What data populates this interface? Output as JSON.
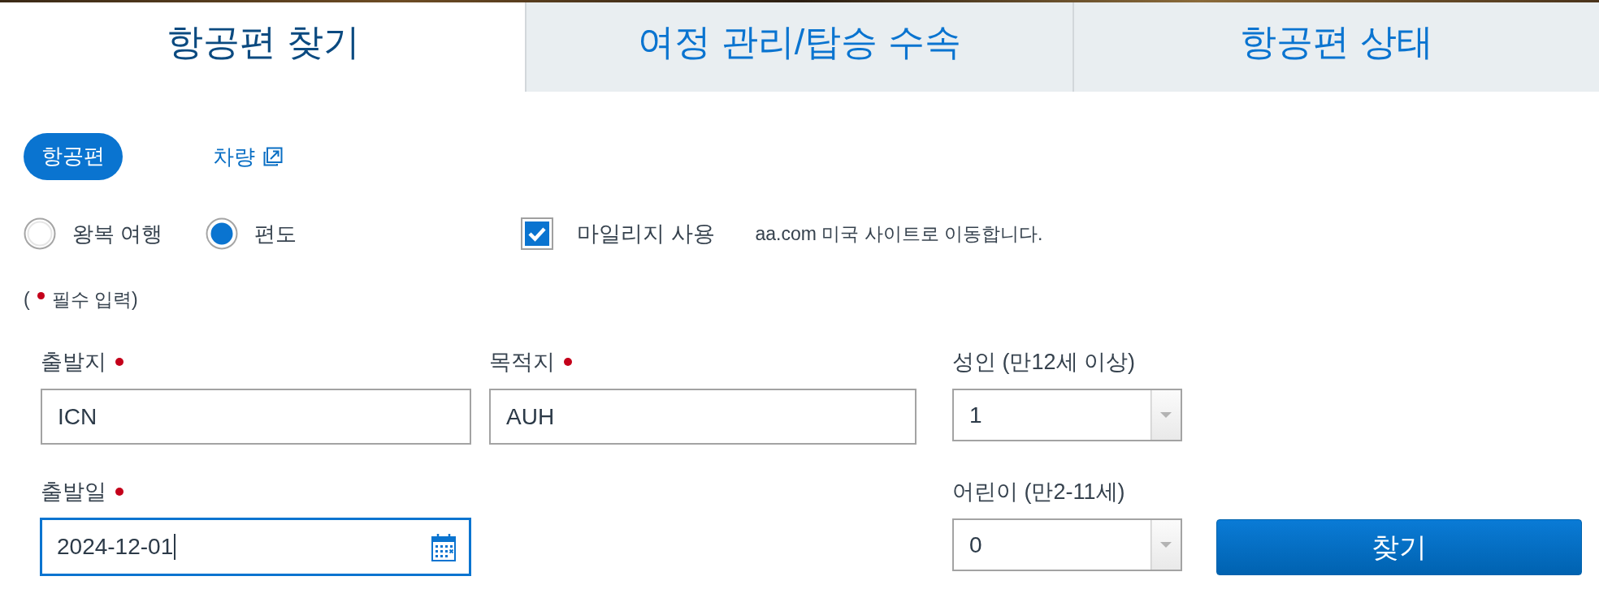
{
  "tabs": [
    {
      "label": "항공편 찾기",
      "selected": true
    },
    {
      "label": "여정 관리/탑승 수속",
      "selected": false
    },
    {
      "label": "항공편 상태",
      "selected": false
    }
  ],
  "modes": [
    {
      "label": "항공편",
      "selected": true,
      "external": false
    },
    {
      "label": "차량",
      "selected": false,
      "external": true
    }
  ],
  "trip_types": [
    {
      "label": "왕복 여행",
      "selected": false
    },
    {
      "label": "편도",
      "selected": true
    }
  ],
  "miles": {
    "label": "마일리지 사용",
    "checked": true,
    "note": "aa.com 미국 사이트로 이동합니다."
  },
  "required_legend": {
    "open": "(",
    "text": "필수 입력)"
  },
  "fields": [
    {
      "kind": "text",
      "label": "출발지",
      "required": true,
      "value": "ICN",
      "focused": false
    },
    {
      "kind": "text",
      "label": "목적지",
      "required": true,
      "value": "AUH",
      "focused": false
    },
    {
      "kind": "select",
      "label": "성인 (만12세 이상)",
      "required": false,
      "value": "1",
      "focused": false
    },
    {
      "kind": "date",
      "label": "출발일",
      "required": true,
      "value": "2024-12-01",
      "focused": true
    },
    {
      "kind": "select",
      "label": "어린이 (만2-11세)",
      "required": false,
      "value": "0",
      "focused": false
    }
  ],
  "search_button": {
    "label": "찾기"
  }
}
